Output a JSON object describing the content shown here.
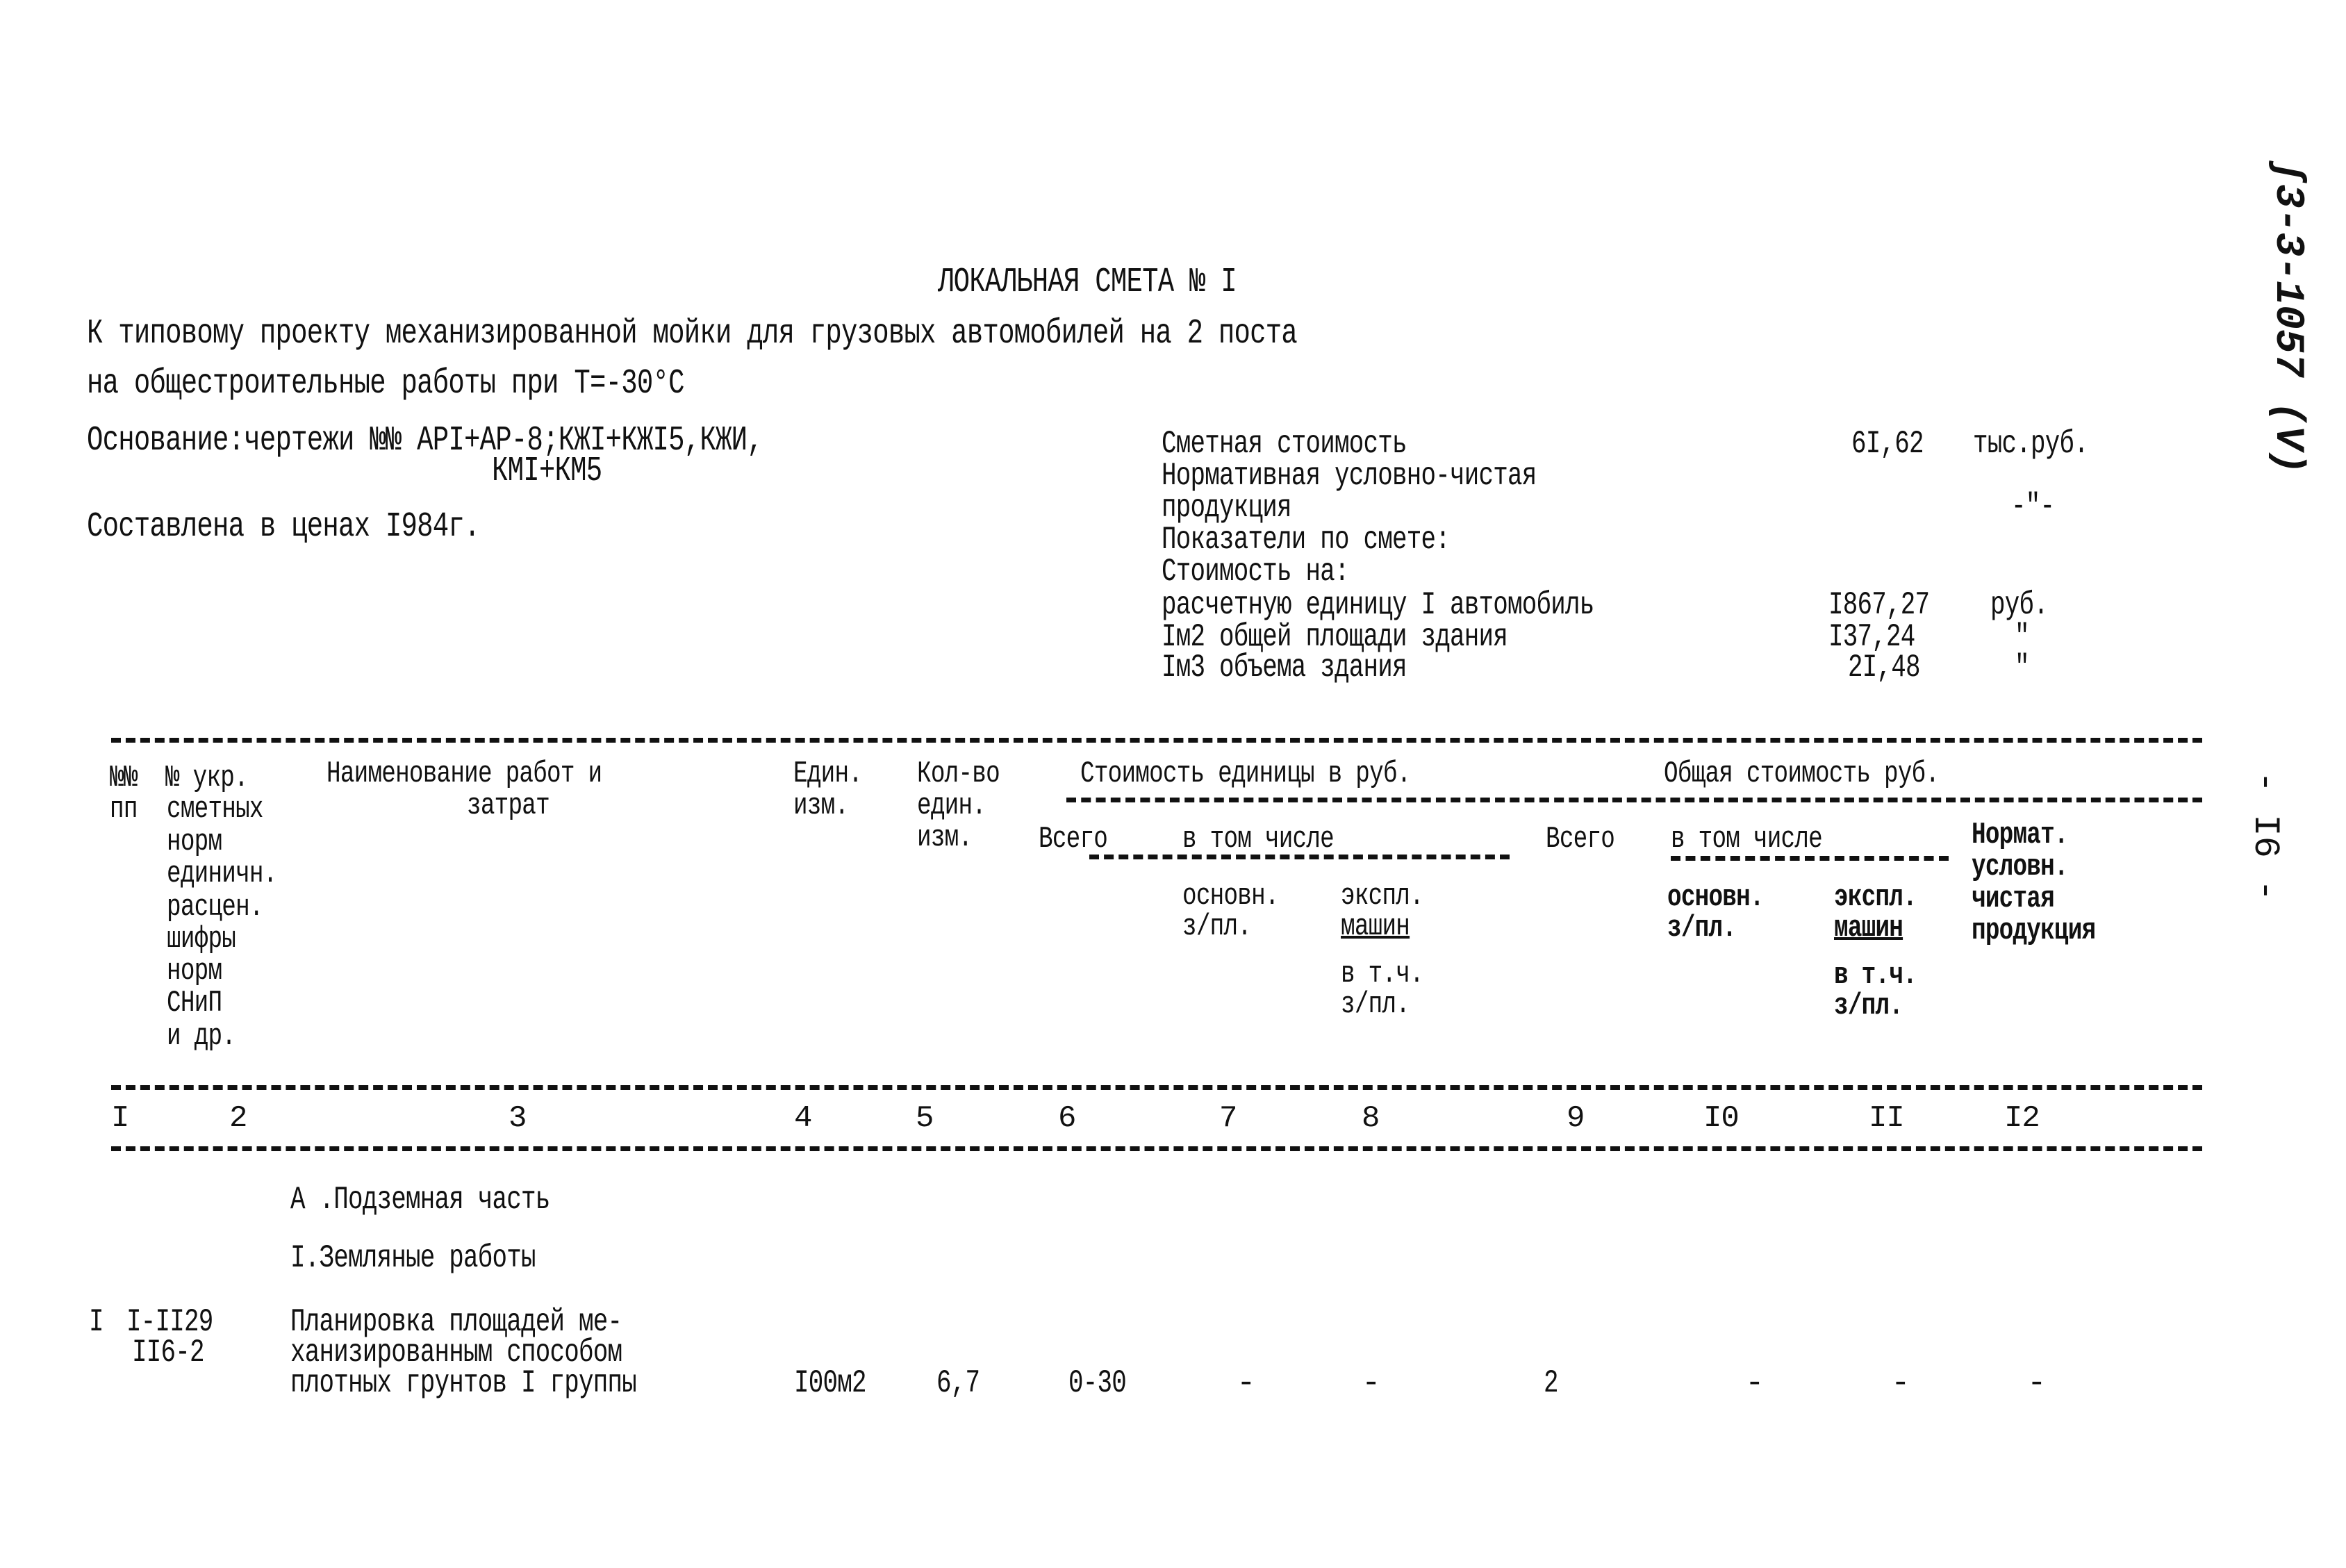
{
  "document": {
    "title": "ЛОКАЛЬНАЯ СМЕТА № I",
    "subtitle_line1": "К типовому проекту механизированной мойки для грузовых автомобилей на 2 поста",
    "subtitle_line2": "на общестроительные работы при Т=-30°С",
    "basis_line1": "Основание:чертежи №№ АРI+АР-8;КЖI+КЖI5,КЖИ,",
    "basis_line2": "КМI+КМ5",
    "prices_note": "Составлена в ценах I984г."
  },
  "summary": {
    "cost_label": "Сметная стоимость",
    "cost_value": "6I,62",
    "cost_unit": "тыс.руб.",
    "normative_label1": "Нормативная условно-чистая",
    "normative_label2": "продукция",
    "normative_value": "-\"-",
    "indicators_label": "Показатели по смете:",
    "cost_on_label": "Стоимость на:",
    "indicators": [
      {
        "label": "расчетную единицу I автомобиль",
        "value": "I867,27",
        "unit": "руб."
      },
      {
        "label": "Iм2 общей площади здания",
        "value": "I37,24",
        "unit": "\""
      },
      {
        "label": "Iм3 объема здания",
        "value": "2I,48",
        "unit": "\""
      }
    ]
  },
  "table": {
    "headers": {
      "col1": [
        "№№",
        "пп"
      ],
      "col2": [
        "№ укр.",
        "сметных",
        "норм",
        "единичн.",
        "расцен.",
        "шифры",
        "норм",
        "СНиП",
        "и др."
      ],
      "col3": [
        "Наименование работ и",
        "затрат"
      ],
      "col4": [
        "Един.",
        "изм."
      ],
      "col5": [
        "Кол-во",
        "един.",
        "изм."
      ],
      "unit_cost_group": "Стоимость единицы в руб.",
      "unit_total": "Всего",
      "unit_incl": "в том числе",
      "unit_basic": [
        "основн.",
        "з/пл."
      ],
      "unit_machine": [
        "экспл.",
        "машин",
        "в т.ч.",
        "з/пл."
      ],
      "total_cost_group": "Общая стоимость руб.",
      "total_total": "Всего",
      "total_incl": "в том числе",
      "total_basic": [
        "основн.",
        "з/пл."
      ],
      "total_machine": [
        "экспл.",
        "машин",
        "в т.ч.",
        "з/пл."
      ],
      "normative": [
        "Нормат.",
        "условн.",
        "чистая",
        "продукция"
      ]
    },
    "column_numbers": [
      "I",
      "2",
      "3",
      "4",
      "5",
      "6",
      "7",
      "8",
      "9",
      "I0",
      "II",
      "I2"
    ],
    "section_a": "А .Подземная часть",
    "section_1": "I.Земляные работы",
    "rows": [
      {
        "num": "I",
        "code": [
          "I-II29",
          "II6-2"
        ],
        "name": [
          "Планировка площадей ме-",
          "ханизированным способом",
          "плотных грунтов I группы"
        ],
        "unit": "I00м2",
        "qty": "6,7",
        "unit_total": "0-30",
        "unit_basic": "-",
        "unit_machine": "-",
        "total": "2",
        "total_basic": "-",
        "total_machine": "-",
        "normative": "-"
      }
    ]
  },
  "margin": {
    "doc_code": "ʃ3-3-1057 (V)",
    "page_number": "- I6 -"
  }
}
